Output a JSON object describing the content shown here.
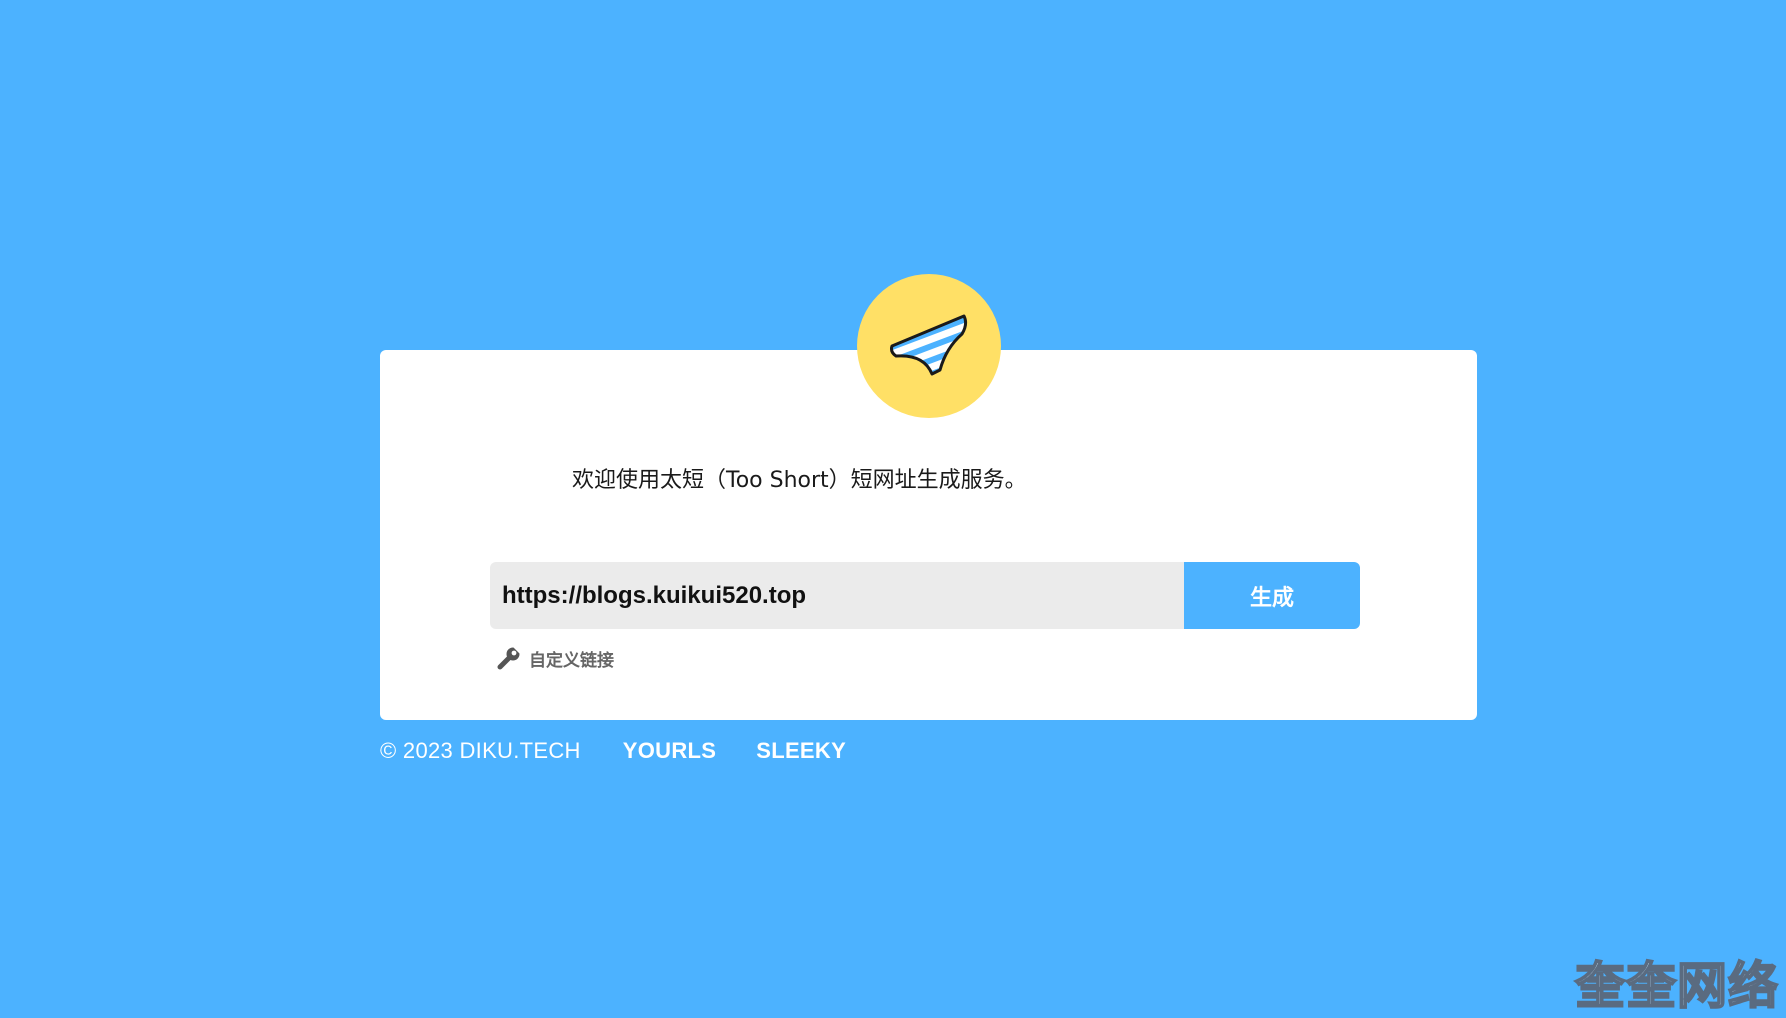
{
  "logo": {
    "icon": "striped-underwear-icon",
    "circle_color": "#ffe066"
  },
  "welcome_text": "欢迎使用太短（Too Short）短网址生成服务。",
  "form": {
    "url_value": "https://blogs.kuikui520.top",
    "submit_label": "生成",
    "custom_link_icon": "wrench-icon",
    "custom_link_label": "自定义链接"
  },
  "footer": {
    "copyright": "© 2023 DIKU.TECH",
    "links": [
      "YOURLS",
      "SLEEKY"
    ]
  },
  "watermark": "奎奎网络",
  "colors": {
    "background": "#4cb2ff",
    "accent": "#4cb2ff",
    "card": "#ffffff",
    "input_bg": "#ebebeb"
  }
}
